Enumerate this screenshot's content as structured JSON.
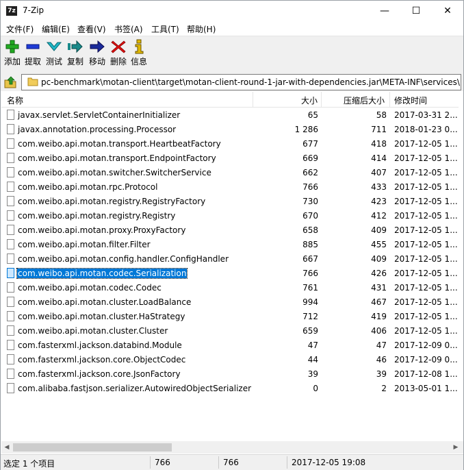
{
  "window": {
    "title": "7-Zip",
    "app_icon_text": "7z"
  },
  "titlebar_buttons": {
    "minimize": "—",
    "maximize": "☐",
    "close": "✕"
  },
  "menu": [
    "文件(F)",
    "编辑(E)",
    "查看(V)",
    "书签(A)",
    "工具(T)",
    "帮助(H)"
  ],
  "toolbar": [
    {
      "label": "添加",
      "icon": "plus-icon",
      "color": "#22aa22"
    },
    {
      "label": "提取",
      "icon": "minus-icon",
      "color": "#1f3bd6"
    },
    {
      "label": "测试",
      "icon": "check-icon",
      "color": "#1fb7c6"
    },
    {
      "label": "复制",
      "icon": "copy-arrow-icon",
      "color": "#1a8a8a"
    },
    {
      "label": "移动",
      "icon": "move-arrow-icon",
      "color": "#1a2a9a"
    },
    {
      "label": "删除",
      "icon": "delete-x-icon",
      "color": "#e01010"
    },
    {
      "label": "信息",
      "icon": "info-icon",
      "color": "#e0b800"
    }
  ],
  "address": {
    "path": "pc-benchmark\\motan-client\\target\\motan-client-round-1-jar-with-dependencies.jar\\META-INF\\services\\"
  },
  "columns": {
    "name": "名称",
    "size": "大小",
    "packed": "压缩后大小",
    "modified": "修改时间"
  },
  "files": [
    {
      "name": "javax.servlet.ServletContainerInitializer",
      "size": "65",
      "packed": "58",
      "modified": "2017-03-31 2..."
    },
    {
      "name": "javax.annotation.processing.Processor",
      "size": "1 286",
      "packed": "711",
      "modified": "2018-01-23 0..."
    },
    {
      "name": "com.weibo.api.motan.transport.HeartbeatFactory",
      "size": "677",
      "packed": "418",
      "modified": "2017-12-05 1..."
    },
    {
      "name": "com.weibo.api.motan.transport.EndpointFactory",
      "size": "669",
      "packed": "414",
      "modified": "2017-12-05 1..."
    },
    {
      "name": "com.weibo.api.motan.switcher.SwitcherService",
      "size": "662",
      "packed": "407",
      "modified": "2017-12-05 1..."
    },
    {
      "name": "com.weibo.api.motan.rpc.Protocol",
      "size": "766",
      "packed": "433",
      "modified": "2017-12-05 1..."
    },
    {
      "name": "com.weibo.api.motan.registry.RegistryFactory",
      "size": "730",
      "packed": "423",
      "modified": "2017-12-05 1..."
    },
    {
      "name": "com.weibo.api.motan.registry.Registry",
      "size": "670",
      "packed": "412",
      "modified": "2017-12-05 1..."
    },
    {
      "name": "com.weibo.api.motan.proxy.ProxyFactory",
      "size": "658",
      "packed": "409",
      "modified": "2017-12-05 1..."
    },
    {
      "name": "com.weibo.api.motan.filter.Filter",
      "size": "885",
      "packed": "455",
      "modified": "2017-12-05 1..."
    },
    {
      "name": "com.weibo.api.motan.config.handler.ConfigHandler",
      "size": "667",
      "packed": "409",
      "modified": "2017-12-05 1..."
    },
    {
      "name": "com.weibo.api.motan.codec.Serialization",
      "size": "766",
      "packed": "426",
      "modified": "2017-12-05 1...",
      "selected": true
    },
    {
      "name": "com.weibo.api.motan.codec.Codec",
      "size": "761",
      "packed": "431",
      "modified": "2017-12-05 1..."
    },
    {
      "name": "com.weibo.api.motan.cluster.LoadBalance",
      "size": "994",
      "packed": "467",
      "modified": "2017-12-05 1..."
    },
    {
      "name": "com.weibo.api.motan.cluster.HaStrategy",
      "size": "712",
      "packed": "419",
      "modified": "2017-12-05 1..."
    },
    {
      "name": "com.weibo.api.motan.cluster.Cluster",
      "size": "659",
      "packed": "406",
      "modified": "2017-12-05 1..."
    },
    {
      "name": "com.fasterxml.jackson.databind.Module",
      "size": "47",
      "packed": "47",
      "modified": "2017-12-09 0..."
    },
    {
      "name": "com.fasterxml.jackson.core.ObjectCodec",
      "size": "44",
      "packed": "46",
      "modified": "2017-12-09 0..."
    },
    {
      "name": "com.fasterxml.jackson.core.JsonFactory",
      "size": "39",
      "packed": "39",
      "modified": "2017-12-08 1..."
    },
    {
      "name": "com.alibaba.fastjson.serializer.AutowiredObjectSerializer",
      "size": "0",
      "packed": "2",
      "modified": "2013-05-01 1..."
    }
  ],
  "status": {
    "selection": "选定 1 个项目",
    "size": "766",
    "packed": "766",
    "modified": "2017-12-05 19:08"
  },
  "colors": {
    "selection": "#0078d7",
    "toolbar_bg": "#f0f0f0"
  }
}
